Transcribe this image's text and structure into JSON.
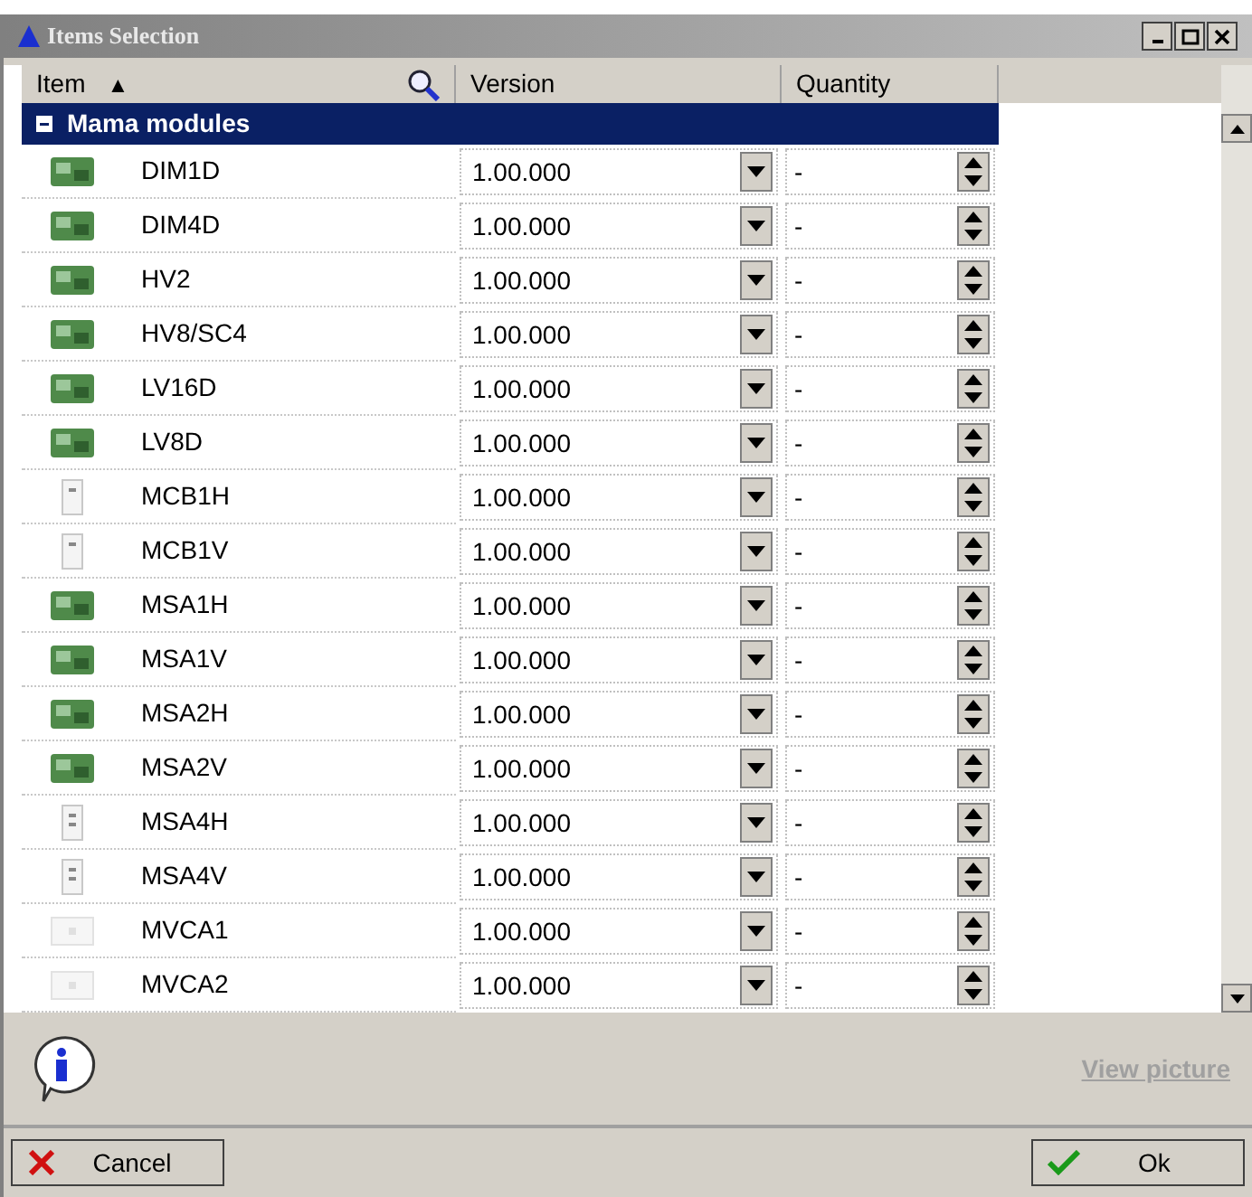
{
  "window": {
    "title": "Items Selection"
  },
  "columns": [
    {
      "label": "Item",
      "sort": "▲"
    },
    {
      "label": "Version"
    },
    {
      "label": "Quantity"
    }
  ],
  "group": {
    "label": "Mama modules",
    "expanded": true
  },
  "rows": [
    {
      "kind": "board",
      "item": "DIM1D",
      "version": "1.00.000",
      "quantity": "-"
    },
    {
      "kind": "board",
      "item": "DIM4D",
      "version": "1.00.000",
      "quantity": "-"
    },
    {
      "kind": "board",
      "item": "HV2",
      "version": "1.00.000",
      "quantity": "-"
    },
    {
      "kind": "board",
      "item": "HV8/SC4",
      "version": "1.00.000",
      "quantity": "-"
    },
    {
      "kind": "board",
      "item": "LV16D",
      "version": "1.00.000",
      "quantity": "-"
    },
    {
      "kind": "board",
      "item": "LV8D",
      "version": "1.00.000",
      "quantity": "-"
    },
    {
      "kind": "single",
      "item": "MCB1H",
      "version": "1.00.000",
      "quantity": "-"
    },
    {
      "kind": "single",
      "item": "MCB1V",
      "version": "1.00.000",
      "quantity": "-"
    },
    {
      "kind": "board",
      "item": "MSA1H",
      "version": "1.00.000",
      "quantity": "-"
    },
    {
      "kind": "board",
      "item": "MSA1V",
      "version": "1.00.000",
      "quantity": "-"
    },
    {
      "kind": "board",
      "item": "MSA2H",
      "version": "1.00.000",
      "quantity": "-"
    },
    {
      "kind": "board",
      "item": "MSA2V",
      "version": "1.00.000",
      "quantity": "-"
    },
    {
      "kind": "double",
      "item": "MSA4H",
      "version": "1.00.000",
      "quantity": "-"
    },
    {
      "kind": "double",
      "item": "MSA4V",
      "version": "1.00.000",
      "quantity": "-"
    },
    {
      "kind": "faint",
      "item": "MVCA1",
      "version": "1.00.000",
      "quantity": "-"
    },
    {
      "kind": "faint",
      "item": "MVCA2",
      "version": "1.00.000",
      "quantity": "-"
    }
  ],
  "link": {
    "label": "View picture",
    "disabled": true
  },
  "buttons": [
    {
      "kind": "cancel",
      "label": "Cancel"
    },
    {
      "kind": "ok",
      "label": "Ok"
    }
  ]
}
